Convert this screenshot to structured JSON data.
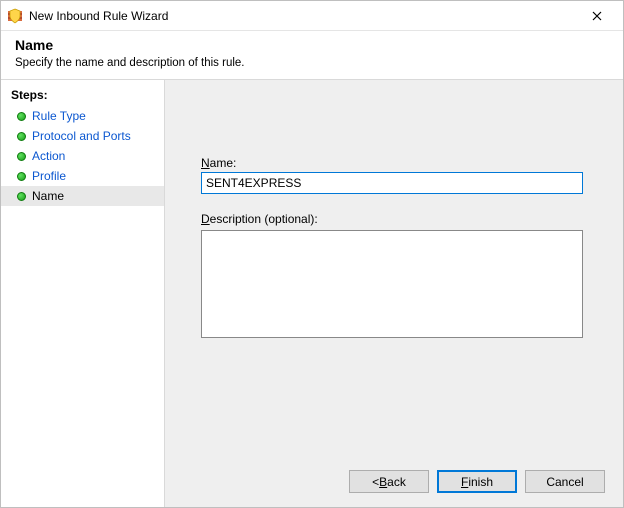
{
  "window": {
    "title": "New Inbound Rule Wizard"
  },
  "header": {
    "title": "Name",
    "subtitle": "Specify the name and description of this rule."
  },
  "sidebar": {
    "title": "Steps:",
    "items": [
      {
        "label": "Rule Type"
      },
      {
        "label": "Protocol and Ports"
      },
      {
        "label": "Action"
      },
      {
        "label": "Profile"
      },
      {
        "label": "Name"
      }
    ]
  },
  "form": {
    "name_label_u": "N",
    "name_label_rest": "ame:",
    "name_value": "SENT4EXPRESS",
    "desc_label_u": "D",
    "desc_label_rest": "escription (optional):",
    "desc_value": ""
  },
  "buttons": {
    "back_lt": "< ",
    "back_u": "B",
    "back_rest": "ack",
    "finish_u": "F",
    "finish_rest": "inish",
    "cancel": "Cancel"
  }
}
